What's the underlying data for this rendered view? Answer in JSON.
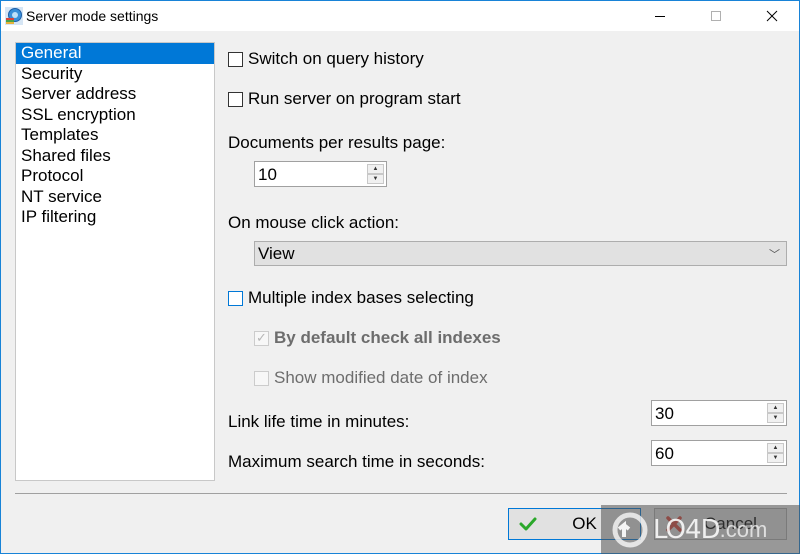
{
  "window": {
    "title": "Server mode settings",
    "controls": {
      "minimize": "minimize",
      "maximize": "maximize",
      "close": "close"
    }
  },
  "sidebar": {
    "selected_index": 0,
    "items": [
      {
        "label": "General"
      },
      {
        "label": "Security"
      },
      {
        "label": "Server address"
      },
      {
        "label": "SSL encryption"
      },
      {
        "label": "Templates"
      },
      {
        "label": "Shared files"
      },
      {
        "label": "Protocol"
      },
      {
        "label": "NT service"
      },
      {
        "label": "IP filtering"
      }
    ]
  },
  "general": {
    "query_history": {
      "label": "Switch on query history",
      "checked": false
    },
    "run_on_start": {
      "label": "Run server on program start",
      "checked": false
    },
    "docs_per_page": {
      "label": "Documents per results page:",
      "value": "10"
    },
    "mouse_click_action": {
      "label": "On mouse click action:",
      "value": "View"
    },
    "multiple_index": {
      "label": "Multiple index bases selecting",
      "checked": false
    },
    "check_all_indexes": {
      "label": "By default check all indexes",
      "checked": true,
      "enabled": false
    },
    "show_modified_date": {
      "label": "Show modified date of index",
      "checked": false,
      "enabled": false
    },
    "link_life_time": {
      "label": "Link life time in minutes:",
      "value": "30"
    },
    "max_search_time": {
      "label": "Maximum search time in seconds:",
      "value": "60"
    }
  },
  "buttons": {
    "ok": "OK",
    "cancel": "Cancel"
  },
  "watermark": {
    "text": "LO4D",
    "suffix": ".com"
  }
}
